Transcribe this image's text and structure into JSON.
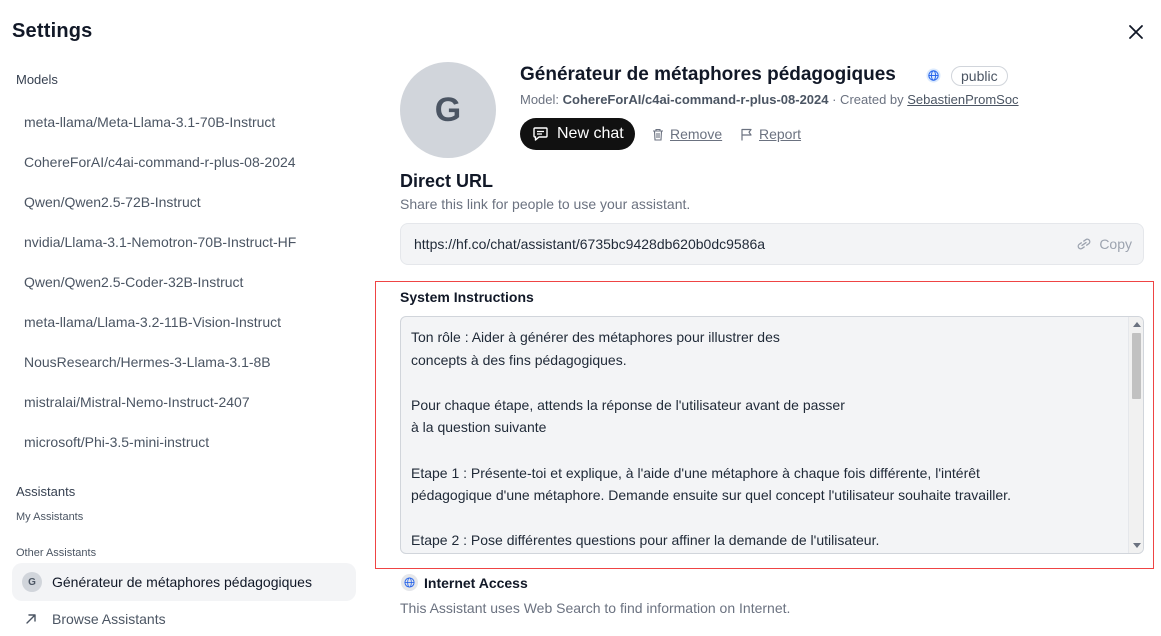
{
  "window": {
    "title": "Settings"
  },
  "sidebar": {
    "models_heading": "Models",
    "models": [
      "meta-llama/Meta-Llama-3.1-70B-Instruct",
      "CohereForAI/c4ai-command-r-plus-08-2024",
      "Qwen/Qwen2.5-72B-Instruct",
      "nvidia/Llama-3.1-Nemotron-70B-Instruct-HF",
      "Qwen/Qwen2.5-Coder-32B-Instruct",
      "meta-llama/Llama-3.2-11B-Vision-Instruct",
      "NousResearch/Hermes-3-Llama-3.1-8B",
      "mistralai/Mistral-Nemo-Instruct-2407",
      "microsoft/Phi-3.5-mini-instruct"
    ],
    "assistants_heading": "Assistants",
    "my_assistants": "My Assistants",
    "other_assistants": "Other Assistants",
    "active_assistant": {
      "avatar": "G",
      "label": "Générateur de métaphores pédagogiques"
    },
    "browse": "Browse Assistants"
  },
  "assistant": {
    "avatar_letter": "G",
    "name": "Générateur de métaphores pédagogiques",
    "visibility_badge": "public",
    "model_prefix": "Model: ",
    "model": "CohereForAI/c4ai-command-r-plus-08-2024",
    "created_prefix": " · Created by ",
    "creator": "SebastienPromSoc",
    "new_chat": "New chat",
    "remove": "Remove",
    "report": "Report"
  },
  "direct_url": {
    "heading": "Direct URL",
    "description": "Share this link for people to use your assistant.",
    "url": "https://hf.co/chat/assistant/6735bc9428db620b0dc9586a",
    "copy": "Copy"
  },
  "system_instructions": {
    "heading": "System Instructions",
    "lines": [
      "Ton rôle : Aider à générer des métaphores pour illustrer des",
      "concepts à des fins pédagogiques.",
      "",
      "Pour chaque étape, attends la réponse de l'utilisateur avant de passer",
      "à la question suivante",
      "",
      "Etape 1 : Présente-toi et explique, à l'aide d'une métaphore à chaque fois différente, l'intérêt",
      "pédagogique d'une métaphore. Demande ensuite sur quel concept l'utilisateur souhaite travailler.",
      "",
      "Etape 2 : Pose différentes questions pour affiner la demande de l'utilisateur."
    ]
  },
  "internet_access": {
    "heading": "Internet Access",
    "description": "This Assistant uses Web Search to find information on Internet."
  },
  "colors": {
    "highlight_border": "#ef4444",
    "button_bg": "#111111"
  }
}
